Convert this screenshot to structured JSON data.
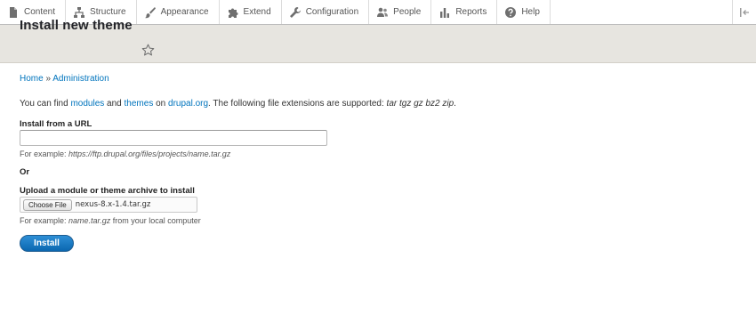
{
  "toolbar": {
    "items": [
      {
        "label": "Content",
        "icon": "document-icon"
      },
      {
        "label": "Structure",
        "icon": "sitemap-icon"
      },
      {
        "label": "Appearance",
        "icon": "paintbrush-icon"
      },
      {
        "label": "Extend",
        "icon": "puzzle-icon"
      },
      {
        "label": "Configuration",
        "icon": "wrench-icon"
      },
      {
        "label": "People",
        "icon": "people-icon"
      },
      {
        "label": "Reports",
        "icon": "bar-chart-icon"
      },
      {
        "label": "Help",
        "icon": "help-icon"
      }
    ],
    "toggle_icon": "orientation-toggle-icon"
  },
  "page": {
    "title": "Install new theme",
    "shortcut_icon": "star-icon"
  },
  "breadcrumb": {
    "home": "Home",
    "separator": "»",
    "admin": "Administration"
  },
  "intro": {
    "part1": "You can find ",
    "modules_link": "modules",
    "part2": " and ",
    "themes_link": "themes",
    "part3": " on ",
    "drupal_link": "drupal.org",
    "part4": ". The following file extensions are supported: ",
    "extensions": "tar tgz gz bz2 zip",
    "part5": "."
  },
  "url_section": {
    "label": "Install from a URL",
    "value": "",
    "hint_prefix": "For example: ",
    "hint_example": "https://ftp.drupal.org/files/projects/name.tar.gz"
  },
  "or_text": "Or",
  "upload_section": {
    "label": "Upload a module or theme archive to install",
    "choose_label": "Choose File",
    "file_name": "nexus-8.x-1.4.tar.gz",
    "hint_prefix": "For example: ",
    "hint_example": "name.tar.gz",
    "hint_suffix": " from your local computer"
  },
  "install_button": "Install",
  "colors": {
    "link": "#0074bd",
    "header_bg": "#e7e5e0",
    "button_blue": "#0b67b0"
  }
}
